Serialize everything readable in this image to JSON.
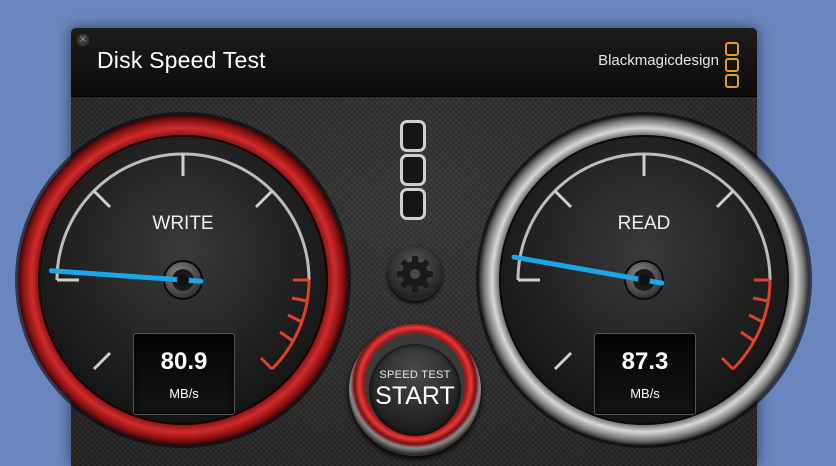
{
  "window": {
    "title": "Disk Speed Test",
    "close_glyph": "×",
    "brand": "Blackmagicdesign"
  },
  "colors": {
    "desktop": "#6b86be",
    "needle": "#19a7ea",
    "red_zone": "#e0402a",
    "brand_logo": "#e39b2b"
  },
  "icons": {
    "close": "close-icon",
    "brand_logo": "blackmagic-logo-icon",
    "gear": "gear-icon",
    "test_steps": "rounded-square-icon"
  },
  "write_gauge": {
    "label": "WRITE",
    "value": "80.9",
    "unit": "MB/s",
    "needle_angle_deg": 184
  },
  "read_gauge": {
    "label": "READ",
    "value": "87.3",
    "unit": "MB/s",
    "needle_angle_deg": 190
  },
  "start_button": {
    "top_label": "SPEED TEST",
    "main_label": "START"
  }
}
